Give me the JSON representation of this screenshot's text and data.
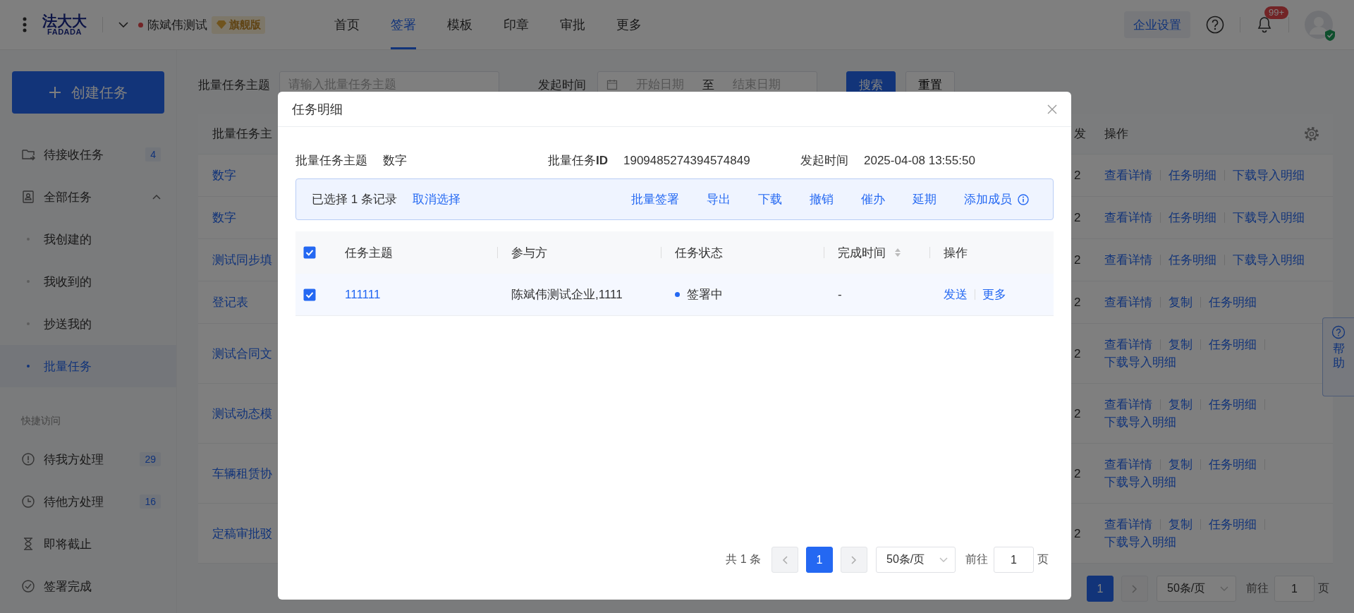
{
  "header": {
    "logo": {
      "mark": "法大大",
      "wordmark": "FADADA"
    },
    "org": {
      "name": "陈斌伟测试",
      "badge": "旗舰版"
    },
    "nav": [
      {
        "label": "首页",
        "selected": false
      },
      {
        "label": "签署",
        "selected": true
      },
      {
        "label": "模板",
        "selected": false
      },
      {
        "label": "印章",
        "selected": false
      },
      {
        "label": "审批",
        "selected": false
      },
      {
        "label": "更多",
        "selected": false
      }
    ],
    "settings_button": "企业设置",
    "notification_count": "99+"
  },
  "sidebar": {
    "create_button": "创建任务",
    "items": [
      {
        "label": "待接收任务",
        "count": "4",
        "selected": false
      },
      {
        "label": "全部任务",
        "expanded": true,
        "selected": false,
        "children": [
          {
            "label": "我创建的",
            "selected": false
          },
          {
            "label": "我收到的",
            "selected": false
          },
          {
            "label": "抄送我的",
            "selected": false
          },
          {
            "label": "批量任务",
            "selected": true
          }
        ]
      }
    ],
    "quick_access": {
      "title": "快捷访问",
      "items": [
        {
          "label": "待我方处理",
          "count": "29",
          "selected": false
        },
        {
          "label": "待他方处理",
          "count": "16",
          "selected": false
        },
        {
          "label": "即将截止",
          "selected": false
        },
        {
          "label": "签署完成",
          "selected": false
        }
      ]
    }
  },
  "filter": {
    "subject_label": "批量任务主题",
    "subject_placeholder": "请输入批量任务主题",
    "time_label": "发起时间",
    "start_placeholder": "开始日期",
    "separator": "至",
    "end_placeholder": "结束日期",
    "search_button": "搜索",
    "reset_button": "重置"
  },
  "table": {
    "columns": [
      "批量任务主",
      "发",
      "操作"
    ],
    "rows": [
      {
        "subject": "数字",
        "column_2": "2",
        "actions": [
          "查看详情",
          "任务明细",
          "下载导入明细"
        ]
      },
      {
        "subject": "数字",
        "column_2": "2",
        "actions": [
          "查看详情",
          "任务明细",
          "下载导入明细"
        ]
      },
      {
        "subject": "测试同步填",
        "column_2": "2",
        "actions": [
          "查看详情",
          "任务明细",
          "下载导入明细"
        ]
      },
      {
        "subject": "登记表",
        "column_2": "2",
        "actions": [
          "查看详情",
          "复制",
          "任务明细"
        ]
      },
      {
        "subject": "测试合同文",
        "column_2": "2",
        "actions": [
          "查看详情",
          "复制",
          "任务明细",
          "下载导入明细"
        ]
      },
      {
        "subject": "测试动态模",
        "column_2": "2",
        "actions": [
          "查看详情",
          "复制",
          "任务明细",
          "下载导入明细"
        ]
      },
      {
        "subject": "车辆租赁协",
        "column_2": "2",
        "actions": [
          "查看详情",
          "复制",
          "任务明细",
          "下载导入明细"
        ]
      },
      {
        "subject": "定稿审批驳",
        "column_2": "2",
        "actions": [
          "查看详情",
          "复制",
          "任务明细",
          "下载导入明细"
        ]
      }
    ]
  },
  "pagination": {
    "current_page": "1",
    "page_size": "50条/页",
    "goto_label": "前往",
    "goto_value": "1",
    "page_suffix": "页"
  },
  "help_tab": "帮助",
  "modal": {
    "title": "任务明细",
    "info": [
      {
        "label": "批量任务主题",
        "value": "数字"
      },
      {
        "label": "批量任务**ID**",
        "value": "1909485274394574849"
      },
      {
        "label": "发起时间",
        "value": "2025-04-08 13:55:50"
      }
    ],
    "selection": {
      "summary": "已选择 1 条记录",
      "clear": "取消选择",
      "actions": [
        "批量签署",
        "导出",
        "下载",
        "撤销",
        "催办",
        "延期",
        "添加成员"
      ]
    },
    "table": {
      "select_all_checked": true,
      "columns": [
        {
          "label": "任务主题",
          "sortable": false
        },
        {
          "label": "参与方",
          "sortable": false
        },
        {
          "label": "任务状态",
          "sortable": false
        },
        {
          "label": "完成时间",
          "sortable": true
        },
        {
          "label": "操作",
          "sortable": false
        }
      ],
      "rows": [
        {
          "checked": true,
          "subject": "111111",
          "parties": "陈斌伟测试企业,1111",
          "status": "签署中",
          "color": "#2468f2",
          "completed": "-",
          "actions": [
            "发送",
            "更多"
          ]
        }
      ]
    },
    "pagination": {
      "total": "共 1 条",
      "current_page": "1",
      "page_size": "50条/页",
      "goto_label": "前往",
      "goto_value": "1",
      "page_suffix": "页"
    }
  }
}
